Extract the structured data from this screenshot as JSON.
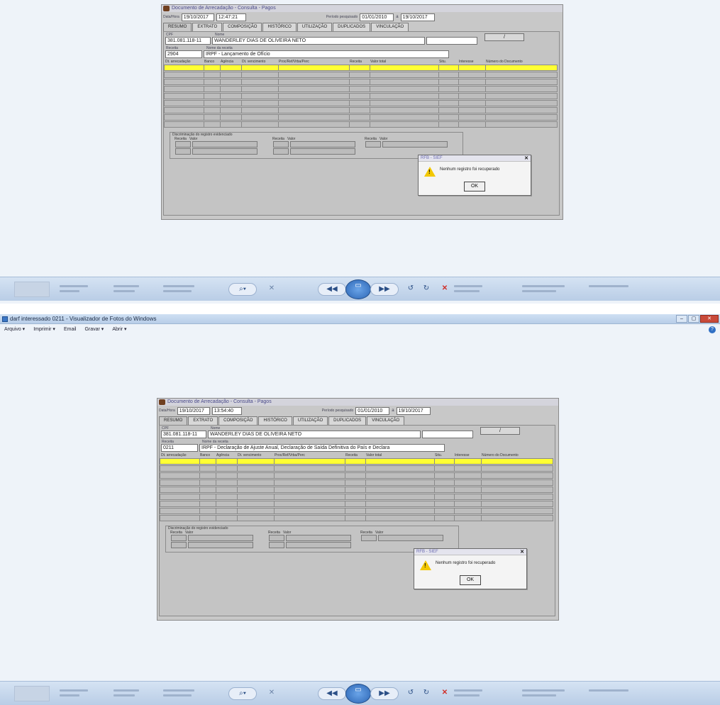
{
  "viewer": {
    "title": "darf interessado 0211 - Visualizador de Fotos do Windows",
    "menu": [
      "Arquivo ▾",
      "Imprimir ▾",
      "Email",
      "Gravar ▾",
      "Abrir ▾"
    ],
    "controls": {
      "zoom": "⌕▾",
      "fit": "✕",
      "prev": "◀◀",
      "slideshow": "▭",
      "next": "▶▶",
      "rotate_ccw": "↺",
      "rotate_cw": "↻",
      "delete": "✕"
    }
  },
  "form1": {
    "title": "Documento de Arrecadação - Consulta - Pagos",
    "datahora_label": "Data/Hora",
    "date": "19/10/2017",
    "time": "12:47:21",
    "periodo_label": "Período pesquisado",
    "period_from": "01/01/2010",
    "period_sep": "a",
    "period_to": "19/10/2017",
    "tabs": [
      "RESUMO",
      "EXTRATO",
      "COMPOSIÇÃO",
      "HISTÓRICO",
      "UTILIZAÇÃO",
      "DUPLICADOS",
      "VINCULAÇÃO"
    ],
    "cpf_label": "CPF",
    "cpf": "381.081.118-11",
    "nome_label": "Nome",
    "nome": "WANDERLEY DIAS DE OLIVEIRA NETO",
    "slash": "/",
    "receita_label": "Receita",
    "nome_receita_label": "Nome da receita",
    "receita": "2904",
    "nome_receita": "IRPF - Lançamento de Ofício",
    "columns": [
      "Dt. arrecadação",
      "Banco",
      "Agência",
      "Dt. vencimento",
      "Proc/Ref/Vrba/Perc",
      "Receita",
      "Valor total",
      "Situ.",
      "Interesse",
      "Número do Documento"
    ],
    "disc_title": "Discriminação do registro evidenciado",
    "disc_receita": "Receita",
    "disc_valor": "Valor",
    "dialog_title": "RFB - SIEF",
    "dialog_msg": "Nenhum registro foi recuperado",
    "ok": "OK"
  },
  "form2": {
    "title": "Documento de Arrecadação - Consulta - Pagos",
    "datahora_label": "Data/Hora",
    "date": "19/10/2017",
    "time": "13:54:40",
    "periodo_label": "Período pesquisado",
    "period_from": "01/01/2010",
    "period_sep": "a",
    "period_to": "19/10/2017",
    "tabs": [
      "RESUMO",
      "EXTRATO",
      "COMPOSIÇÃO",
      "HISTÓRICO",
      "UTILIZAÇÃO",
      "DUPLICADOS",
      "VINCULAÇÃO"
    ],
    "cpf_label": "CPF",
    "cpf": "381.081.118-11",
    "nome_label": "Nome",
    "nome": "WANDERLEY DIAS DE OLIVEIRA NETO",
    "slash": "/",
    "receita_label": "Receita",
    "nome_receita_label": "Nome da receita",
    "receita": "0211",
    "nome_receita": "IRPF - Declaração de Ajuste Anual, Declaração de Saída Definitiva do País e Declara",
    "columns": [
      "Dt. arrecadação",
      "Banco",
      "Agência",
      "Dt. vencimento",
      "Proc/Ref/Vrba/Perc",
      "Receita",
      "Valor total",
      "Situ.",
      "Interesse",
      "Número do Documento"
    ],
    "disc_title": "Discriminação do registro evidenciado",
    "disc_receita": "Receita",
    "disc_valor": "Valor",
    "dialog_title": "RFB - SIEF",
    "dialog_msg": "Nenhum registro foi recuperado",
    "ok": "OK"
  }
}
